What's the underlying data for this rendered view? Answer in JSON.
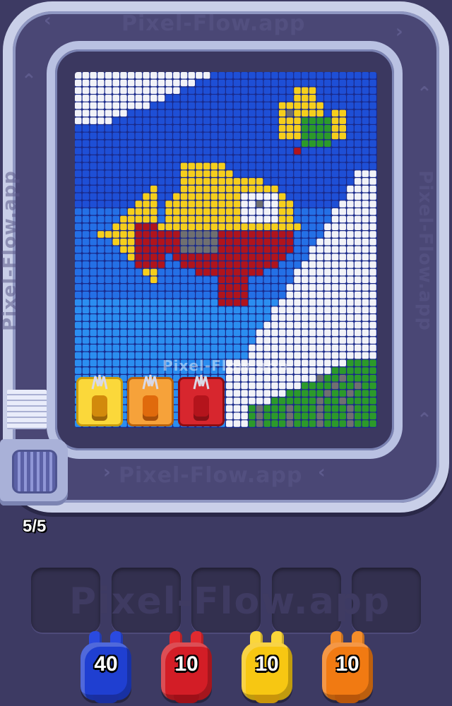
{
  "watermarks": {
    "top": "Pixel-Flow.app",
    "bottom": "Pixel-Flow.app",
    "left": "Pixel-Flow.app",
    "right": "Pixel-Flow.app",
    "canvas": "Pixel-Flow.app",
    "slots": "Pixel-Flow.app"
  },
  "level_progress": "5/5",
  "colors": {
    "sky": "#1e4fd6",
    "sky_light": "#2b8ef0",
    "cloud": "#f2f3f8",
    "yellow": "#f6cf1c",
    "red": "#b0141c",
    "orange": "#f08a12",
    "grey": "#707070",
    "green": "#2c9a2a",
    "blue_piece": "#1f3fd1",
    "red_piece": "#d31d26",
    "yellow_piece": "#f7c712",
    "orange_piece": "#f17a12"
  },
  "conveyor_slots": [
    {
      "color": "yellow",
      "icon": "yellow-shooter-icon"
    },
    {
      "color": "orange",
      "icon": "orange-shooter-icon"
    },
    {
      "color": "red",
      "icon": "red-shooter-icon"
    }
  ],
  "empty_slots": 5,
  "pieces": [
    {
      "color": "blue",
      "count": "40"
    },
    {
      "color": "red",
      "count": "10"
    },
    {
      "color": "yellow",
      "count": "10"
    },
    {
      "color": "orange",
      "count": "10"
    }
  ]
}
